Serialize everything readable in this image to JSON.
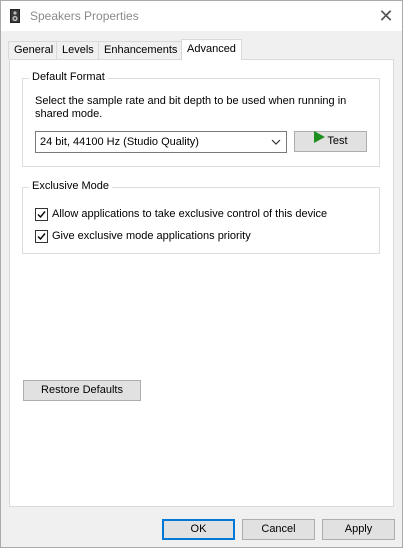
{
  "window": {
    "title": "Speakers Properties",
    "close_glyph": "✕"
  },
  "tabs": [
    {
      "label": "General",
      "active": false
    },
    {
      "label": "Levels",
      "active": false
    },
    {
      "label": "Enhancements",
      "active": false
    },
    {
      "label": "Advanced",
      "active": true
    }
  ],
  "default_format": {
    "group_label": "Default Format",
    "description": "Select the sample rate and bit depth to be used when running in shared mode.",
    "selected_format": "24 bit, 44100 Hz (Studio Quality)",
    "test_label": "Test"
  },
  "exclusive_mode": {
    "group_label": "Exclusive Mode",
    "options": [
      {
        "label": "Allow applications to take exclusive control of this device",
        "checked": true
      },
      {
        "label": "Give exclusive mode applications priority",
        "checked": true
      }
    ]
  },
  "restore_defaults_label": "Restore Defaults",
  "footer": {
    "ok_label": "OK",
    "cancel_label": "Cancel",
    "apply_label": "Apply"
  },
  "colors": {
    "accent": "#0078d7",
    "play_icon": "#1e8f1e",
    "window_bg": "#f0f0f0",
    "panel_bg": "#ffffff"
  },
  "icons": {
    "title": "speaker-icon",
    "close": "close-icon",
    "dropdown": "chevron-down-icon",
    "test": "play-icon",
    "check": "checkmark-icon"
  }
}
